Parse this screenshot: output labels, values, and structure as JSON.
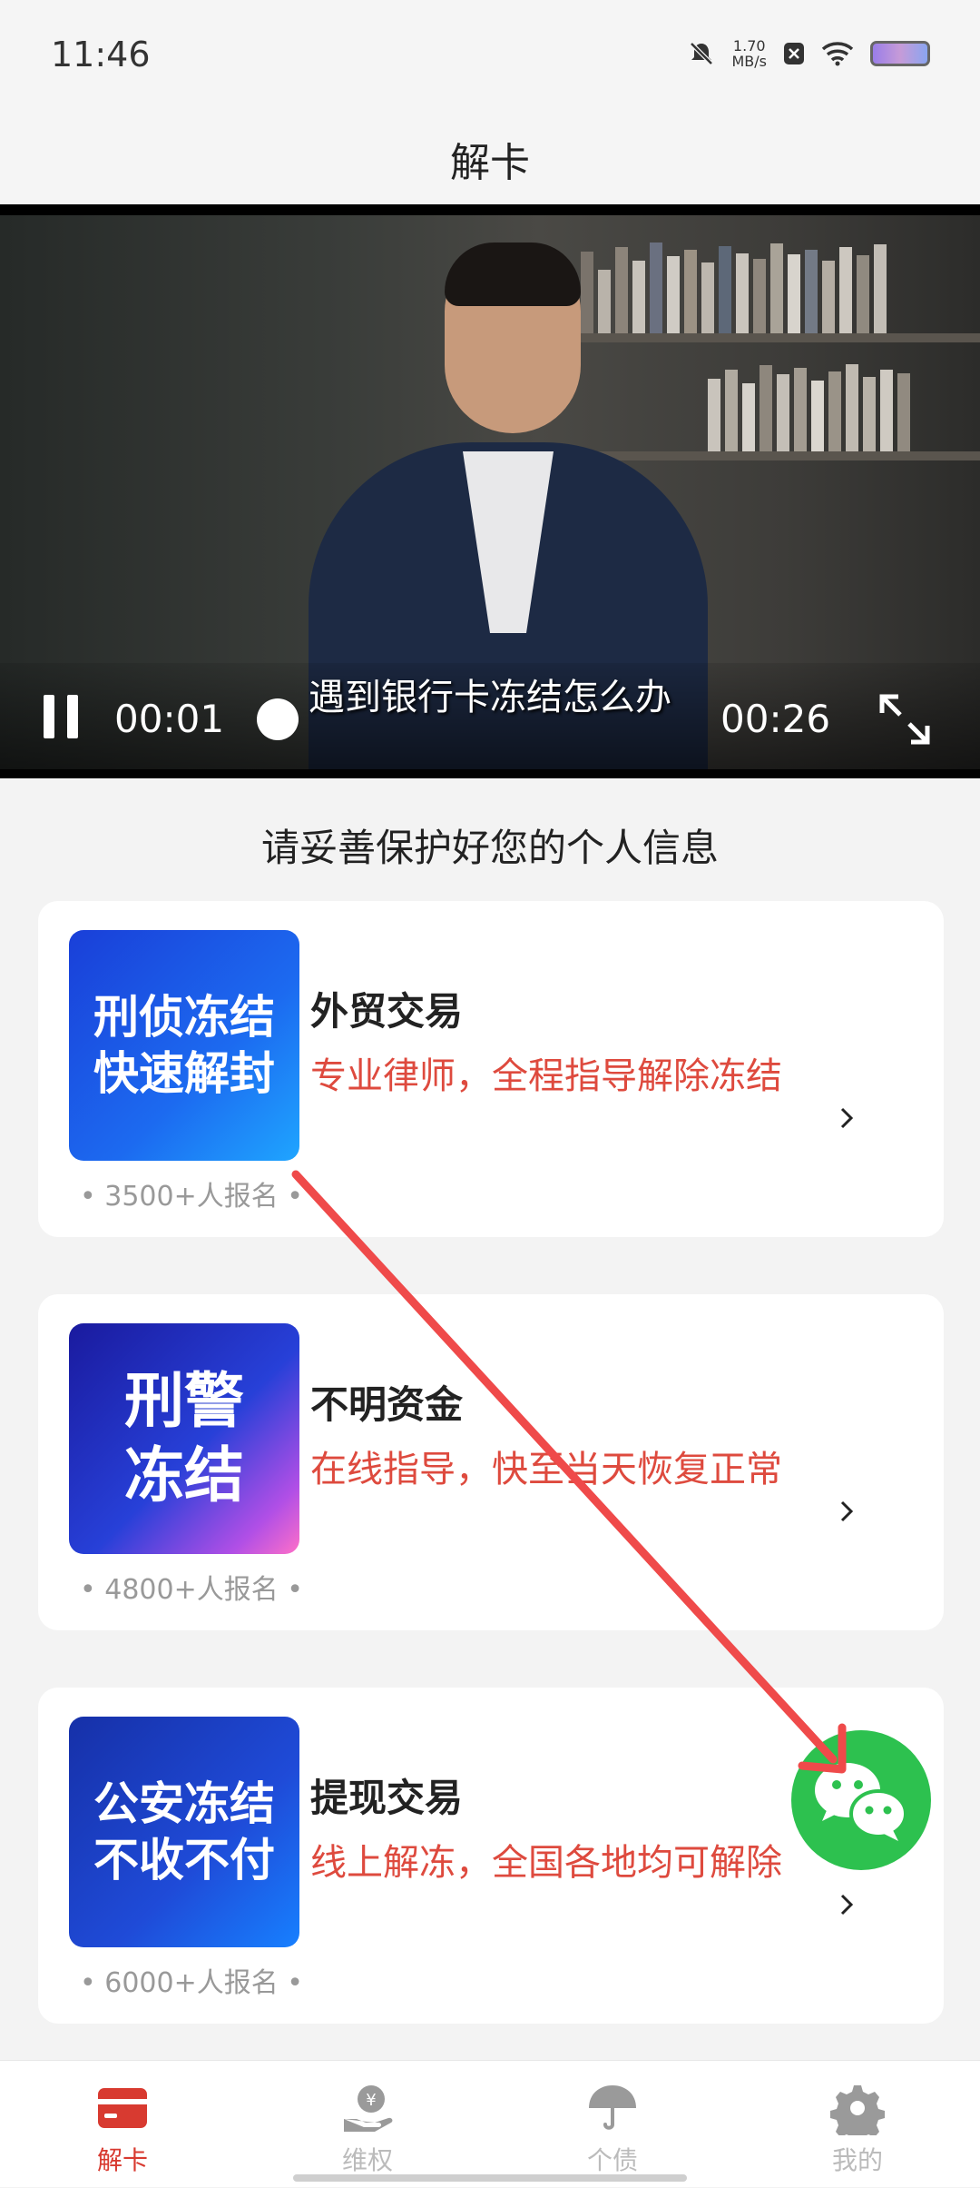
{
  "status_bar": {
    "time": "11:46",
    "net_speed_value": "1.70",
    "net_speed_unit": "MB/s",
    "icons": [
      "mute-bell-icon",
      "close-box-icon",
      "wifi-icon",
      "battery-icon"
    ]
  },
  "nav": {
    "title": "解卡"
  },
  "video": {
    "subtitle": "遇到银行卡冻结怎么办",
    "current_time": "00:01",
    "total_time": "00:26",
    "progress": 0.04
  },
  "section_title": "请妥善保护好您的个人信息",
  "cards": [
    {
      "thumb_line1": "刑侦冻结",
      "thumb_line2": "快速解封",
      "title": "外贸交易",
      "desc": "专业律师，全程指导解除冻结",
      "signups": "•  3500+人报名  •"
    },
    {
      "thumb_line1": "刑警",
      "thumb_line2": "冻结",
      "title": "不明资金",
      "desc": "在线指导，快至当天恢复正常",
      "signups": "•  4800+人报名  •"
    },
    {
      "thumb_line1": "公安冻结",
      "thumb_line2": "不收不付",
      "title": "提现交易",
      "desc": "线上解冻，全国各地均可解除",
      "signups": "•  6000+人报名  •"
    }
  ],
  "tabs": [
    {
      "label": "解卡",
      "icon": "card-icon",
      "active": true
    },
    {
      "label": "维权",
      "icon": "hand-money-icon",
      "active": false
    },
    {
      "label": "个债",
      "icon": "umbrella-icon",
      "active": false
    },
    {
      "label": "我的",
      "icon": "gear-icon",
      "active": false
    }
  ],
  "colors": {
    "accent": "#d83a30",
    "desc_red": "#de4a3e",
    "wechat_green": "#2dc14f",
    "annotation_arrow": "#ef4a4a"
  }
}
